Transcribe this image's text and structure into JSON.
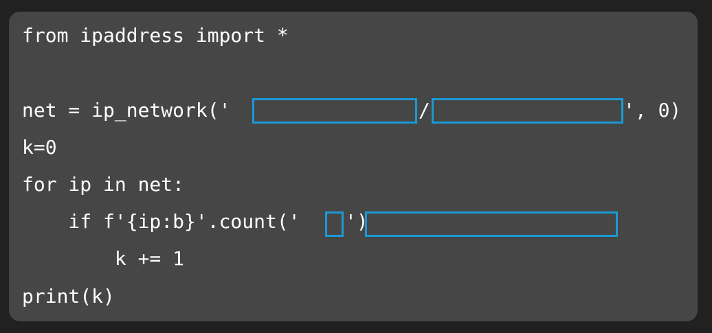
{
  "code": {
    "line1": "from ipaddress import *",
    "line3_prefix": "net = ip_network('",
    "line3_sep": "/",
    "line3_suffix": "', 0)",
    "line4": "k=0",
    "line5": "for ip in net:",
    "line6_prefix": "    if f'{ip:b}'.count('",
    "line6_suffix": "')",
    "line7": "        k += 1",
    "line8": "print(k)"
  },
  "blanks": {
    "ip_address": "",
    "mask": "",
    "count_char": "",
    "condition": ""
  },
  "colors": {
    "page_background": "#212121",
    "card_background": "#464646",
    "text": "#ffffff",
    "blank_border": "#1a9ad6"
  }
}
